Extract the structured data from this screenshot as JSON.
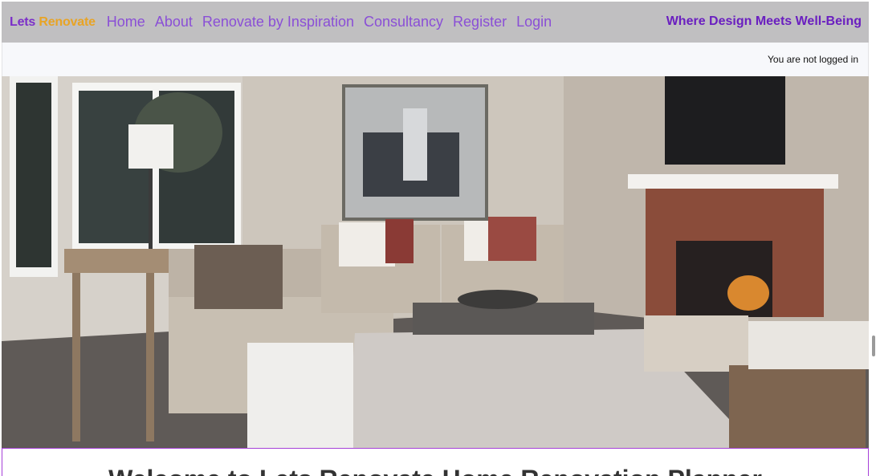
{
  "brand": {
    "part1": "Lets",
    "part2": "Renovate"
  },
  "nav": {
    "items": [
      {
        "label": "Home"
      },
      {
        "label": "About"
      },
      {
        "label": "Renovate by Inspiration"
      },
      {
        "label": "Consultancy"
      },
      {
        "label": "Register"
      },
      {
        "label": "Login"
      }
    ]
  },
  "tagline": "Where Design Meets Well-Being",
  "status": {
    "text": "You are not logged in"
  },
  "hero": {
    "alt": "living room with fireplace"
  },
  "welcome": {
    "title": "Welcome to Lets Renovate Home Renovation Planner"
  },
  "colors": {
    "brand_primary": "#7b2fc9",
    "brand_accent": "#e8a426",
    "nav_link": "#8a4fd6",
    "navbar_bg": "#c0bfc1",
    "welcome_border": "#a640d8"
  }
}
